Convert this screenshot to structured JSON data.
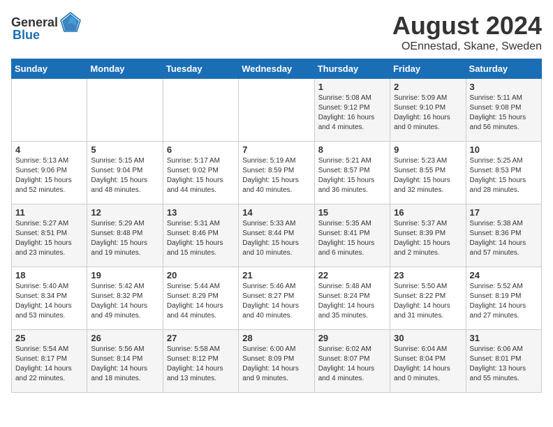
{
  "header": {
    "logo_general": "General",
    "logo_blue": "Blue",
    "month_year": "August 2024",
    "location": "OEnnestad, Skane, Sweden"
  },
  "weekdays": [
    "Sunday",
    "Monday",
    "Tuesday",
    "Wednesday",
    "Thursday",
    "Friday",
    "Saturday"
  ],
  "weeks": [
    [
      {
        "day": "",
        "info": ""
      },
      {
        "day": "",
        "info": ""
      },
      {
        "day": "",
        "info": ""
      },
      {
        "day": "",
        "info": ""
      },
      {
        "day": "1",
        "info": "Sunrise: 5:08 AM\nSunset: 9:12 PM\nDaylight: 16 hours\nand 4 minutes."
      },
      {
        "day": "2",
        "info": "Sunrise: 5:09 AM\nSunset: 9:10 PM\nDaylight: 16 hours\nand 0 minutes."
      },
      {
        "day": "3",
        "info": "Sunrise: 5:11 AM\nSunset: 9:08 PM\nDaylight: 15 hours\nand 56 minutes."
      }
    ],
    [
      {
        "day": "4",
        "info": "Sunrise: 5:13 AM\nSunset: 9:06 PM\nDaylight: 15 hours\nand 52 minutes."
      },
      {
        "day": "5",
        "info": "Sunrise: 5:15 AM\nSunset: 9:04 PM\nDaylight: 15 hours\nand 48 minutes."
      },
      {
        "day": "6",
        "info": "Sunrise: 5:17 AM\nSunset: 9:02 PM\nDaylight: 15 hours\nand 44 minutes."
      },
      {
        "day": "7",
        "info": "Sunrise: 5:19 AM\nSunset: 8:59 PM\nDaylight: 15 hours\nand 40 minutes."
      },
      {
        "day": "8",
        "info": "Sunrise: 5:21 AM\nSunset: 8:57 PM\nDaylight: 15 hours\nand 36 minutes."
      },
      {
        "day": "9",
        "info": "Sunrise: 5:23 AM\nSunset: 8:55 PM\nDaylight: 15 hours\nand 32 minutes."
      },
      {
        "day": "10",
        "info": "Sunrise: 5:25 AM\nSunset: 8:53 PM\nDaylight: 15 hours\nand 28 minutes."
      }
    ],
    [
      {
        "day": "11",
        "info": "Sunrise: 5:27 AM\nSunset: 8:51 PM\nDaylight: 15 hours\nand 23 minutes."
      },
      {
        "day": "12",
        "info": "Sunrise: 5:29 AM\nSunset: 8:48 PM\nDaylight: 15 hours\nand 19 minutes."
      },
      {
        "day": "13",
        "info": "Sunrise: 5:31 AM\nSunset: 8:46 PM\nDaylight: 15 hours\nand 15 minutes."
      },
      {
        "day": "14",
        "info": "Sunrise: 5:33 AM\nSunset: 8:44 PM\nDaylight: 15 hours\nand 10 minutes."
      },
      {
        "day": "15",
        "info": "Sunrise: 5:35 AM\nSunset: 8:41 PM\nDaylight: 15 hours\nand 6 minutes."
      },
      {
        "day": "16",
        "info": "Sunrise: 5:37 AM\nSunset: 8:39 PM\nDaylight: 15 hours\nand 2 minutes."
      },
      {
        "day": "17",
        "info": "Sunrise: 5:38 AM\nSunset: 8:36 PM\nDaylight: 14 hours\nand 57 minutes."
      }
    ],
    [
      {
        "day": "18",
        "info": "Sunrise: 5:40 AM\nSunset: 8:34 PM\nDaylight: 14 hours\nand 53 minutes."
      },
      {
        "day": "19",
        "info": "Sunrise: 5:42 AM\nSunset: 8:32 PM\nDaylight: 14 hours\nand 49 minutes."
      },
      {
        "day": "20",
        "info": "Sunrise: 5:44 AM\nSunset: 8:29 PM\nDaylight: 14 hours\nand 44 minutes."
      },
      {
        "day": "21",
        "info": "Sunrise: 5:46 AM\nSunset: 8:27 PM\nDaylight: 14 hours\nand 40 minutes."
      },
      {
        "day": "22",
        "info": "Sunrise: 5:48 AM\nSunset: 8:24 PM\nDaylight: 14 hours\nand 35 minutes."
      },
      {
        "day": "23",
        "info": "Sunrise: 5:50 AM\nSunset: 8:22 PM\nDaylight: 14 hours\nand 31 minutes."
      },
      {
        "day": "24",
        "info": "Sunrise: 5:52 AM\nSunset: 8:19 PM\nDaylight: 14 hours\nand 27 minutes."
      }
    ],
    [
      {
        "day": "25",
        "info": "Sunrise: 5:54 AM\nSunset: 8:17 PM\nDaylight: 14 hours\nand 22 minutes."
      },
      {
        "day": "26",
        "info": "Sunrise: 5:56 AM\nSunset: 8:14 PM\nDaylight: 14 hours\nand 18 minutes."
      },
      {
        "day": "27",
        "info": "Sunrise: 5:58 AM\nSunset: 8:12 PM\nDaylight: 14 hours\nand 13 minutes."
      },
      {
        "day": "28",
        "info": "Sunrise: 6:00 AM\nSunset: 8:09 PM\nDaylight: 14 hours\nand 9 minutes."
      },
      {
        "day": "29",
        "info": "Sunrise: 6:02 AM\nSunset: 8:07 PM\nDaylight: 14 hours\nand 4 minutes."
      },
      {
        "day": "30",
        "info": "Sunrise: 6:04 AM\nSunset: 8:04 PM\nDaylight: 14 hours\nand 0 minutes."
      },
      {
        "day": "31",
        "info": "Sunrise: 6:06 AM\nSunset: 8:01 PM\nDaylight: 13 hours\nand 55 minutes."
      }
    ]
  ]
}
